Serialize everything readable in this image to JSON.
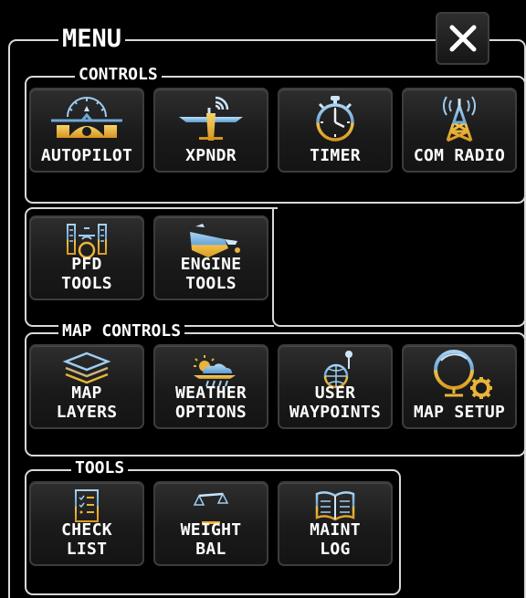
{
  "menu": {
    "title": "MENU",
    "close_icon": "close-x-icon"
  },
  "controls": {
    "title": "CONTROLS",
    "buttons": [
      {
        "label": "AUTOPILOT",
        "icon": "autopilot-icon"
      },
      {
        "label": "XPNDR",
        "icon": "transponder-icon"
      },
      {
        "label": "TIMER",
        "icon": "stopwatch-icon"
      },
      {
        "label": "COM RADIO",
        "icon": "radio-tower-icon"
      },
      {
        "label": "PFD\nTOOLS",
        "icon": "pfd-icon"
      },
      {
        "label": "ENGINE\nTOOLS",
        "icon": "oil-can-icon"
      }
    ]
  },
  "map_controls": {
    "title": "MAP CONTROLS",
    "buttons": [
      {
        "label": "MAP\nLAYERS",
        "icon": "layers-icon"
      },
      {
        "label": "WEATHER\nOPTIONS",
        "icon": "weather-icon"
      },
      {
        "label": "USER\nWAYPOINTS",
        "icon": "waypoint-globe-icon"
      },
      {
        "label": "MAP SETUP",
        "icon": "globe-gear-icon"
      }
    ]
  },
  "tools": {
    "title": "TOOLS",
    "buttons": [
      {
        "label": "CHECK\nLIST",
        "icon": "checklist-icon"
      },
      {
        "label": "WEIGHT\nBAL",
        "icon": "scale-icon"
      },
      {
        "label": "MAINT\nLOG",
        "icon": "logbook-icon"
      }
    ]
  },
  "colors": {
    "accent_gold": "#e8b43a",
    "accent_blue": "#7fb8e6",
    "frame": "#d9d9d9"
  }
}
